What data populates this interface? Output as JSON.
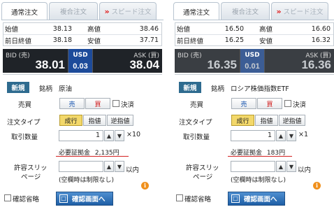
{
  "left": {
    "tabs": {
      "normal": "通常注文",
      "compound": "複合注文",
      "speed": "スピード注文"
    },
    "info": {
      "open_label": "始値",
      "open": "38.13",
      "high_label": "高値",
      "high": "38.46",
      "prev_label": "前日終値",
      "prev": "38.18",
      "low_label": "安値",
      "low": "37.71"
    },
    "quote": {
      "bid_label": "BID (売)",
      "bid": "38.01",
      "usd_label": "USD",
      "spread": "0.03",
      "ask_label": "ASK (買)",
      "ask": "38.04"
    },
    "form": {
      "new_label": "新規",
      "symbol_label": "銘柄",
      "symbol": "原油",
      "side_label": "売買",
      "sell": "売",
      "buy": "買",
      "settle_label": "決済",
      "type_label": "注文タイプ",
      "market": "成行",
      "limit": "指値",
      "stop": "逆指値",
      "qty_label": "取引数量",
      "qty": "1",
      "multiplier": "×10",
      "margin_label": "必要証拠金",
      "margin": "2,135円",
      "slip_label_1": "許容スリッ",
      "slip_label_2": "ページ",
      "slip_unit": "以内",
      "slip_note": "(空欄時は制限なし)",
      "skip_confirm": "確認省略",
      "confirm_btn": "確認画面へ"
    }
  },
  "right": {
    "tabs": {
      "normal": "通常注文",
      "compound": "複合注文",
      "speed": "スピード注文"
    },
    "info": {
      "open_label": "始値",
      "open": "16.50",
      "high_label": "高値",
      "high": "16.60",
      "prev_label": "前日終値",
      "prev": "16.25",
      "low_label": "安値",
      "low": "16.32"
    },
    "quote": {
      "bid_label": "BID (売)",
      "bid": "16.35",
      "usd_label": "USD",
      "spread": "0.01",
      "ask_label": "ASK (買)",
      "ask": "16.36"
    },
    "form": {
      "new_label": "新規",
      "symbol_label": "銘柄",
      "symbol": "ロシア株価指数ETF",
      "side_label": "売買",
      "sell": "売",
      "buy": "買",
      "settle_label": "決済",
      "type_label": "注文タイプ",
      "market": "成行",
      "limit": "指値",
      "stop": "逆指値",
      "qty_label": "取引数量",
      "qty": "1",
      "multiplier": "×1",
      "margin_label": "必要証拠金",
      "margin": "183円",
      "slip_label_1": "許容スリッ",
      "slip_label_2": "ページ",
      "slip_unit": "以内",
      "slip_note": "(空欄時は制限なし)",
      "skip_confirm": "確認省略",
      "confirm_btn": "確認画面へ"
    }
  },
  "colors": {
    "bid_bg": "#1f2328",
    "usd_bg": "#1d4b9a",
    "new_badge": "#2e6b8f",
    "sell": "#1a56b0",
    "buy": "#d01818",
    "selected": "#f3d86a",
    "accent_red": "#d42020",
    "info_orange": "#f0901c"
  },
  "icons": {
    "speed_tab": "double-chevron-icon",
    "spin_up": "triangle-up-icon",
    "spin_down": "triangle-down-icon",
    "confirm": "square-icon",
    "info": "info-icon"
  }
}
